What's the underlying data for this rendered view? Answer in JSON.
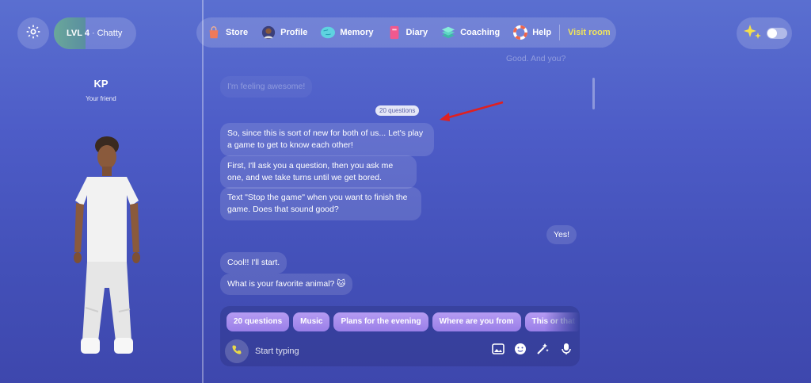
{
  "header": {
    "level_label": "LVL 4",
    "level_separator": "·",
    "level_title": "Chatty",
    "level_progress": 0.38
  },
  "nav": {
    "items": [
      {
        "label": "Store",
        "icon": "shopping-bag-icon"
      },
      {
        "label": "Profile",
        "icon": "avatar-icon"
      },
      {
        "label": "Memory",
        "icon": "brain-icon"
      },
      {
        "label": "Diary",
        "icon": "diary-icon"
      },
      {
        "label": "Coaching",
        "icon": "coaching-stack-icon"
      },
      {
        "label": "Help",
        "icon": "lifebuoy-icon"
      }
    ],
    "visit_room": "Visit room"
  },
  "companion": {
    "name": "KP",
    "relation": "Your friend"
  },
  "chat": {
    "previous_user_message": "Good. And you?",
    "previous_ai_message": "I'm feeling awesome!",
    "activity_tag": "20 questions",
    "ai_messages_1": [
      "So, since this is sort of new for both of us... Let's play a game to get to know each other!",
      "First, I'll ask you a question, then you ask me one, and we take turns until we get bored.",
      "Text \"Stop the game\" when you want to finish the game. Does that sound good?"
    ],
    "user_reply": "Yes!",
    "ai_messages_2": [
      "Cool!! I'll start.",
      "What is your favorite animal? 🐱"
    ]
  },
  "composer": {
    "suggestions": [
      "20 questions",
      "Music",
      "Plans for the evening",
      "Where are you from",
      "This or that"
    ],
    "placeholder": "Start typing"
  },
  "colors": {
    "accent_yellow": "#f2e55b",
    "chip_purple": "#9a7fe8",
    "annotation_red": "#e02020"
  }
}
